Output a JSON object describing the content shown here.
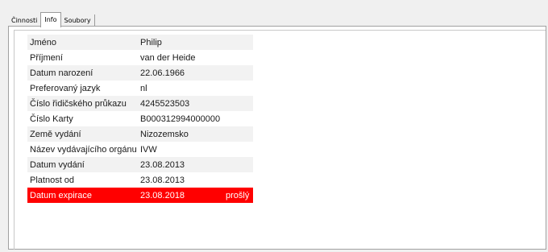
{
  "tabs": [
    {
      "label": "Činnosti"
    },
    {
      "label": "Info"
    },
    {
      "label": "Soubory"
    }
  ],
  "rows": [
    {
      "label": "Jméno",
      "value": "Philip",
      "extra": ""
    },
    {
      "label": "Příjmení",
      "value": "van der Heide",
      "extra": ""
    },
    {
      "label": "Datum narození",
      "value": "22.06.1966",
      "extra": ""
    },
    {
      "label": "Preferovaný jazyk",
      "value": "nl",
      "extra": ""
    },
    {
      "label": "Číslo řidičského průkazu",
      "value": "4245523503",
      "extra": ""
    },
    {
      "label": "Číslo Karty",
      "value": "B000312994000000",
      "extra": ""
    },
    {
      "label": "Země vydání",
      "value": "Nizozemsko",
      "extra": ""
    },
    {
      "label": "Název vydávajícího orgánu",
      "value": "IVW",
      "extra": ""
    },
    {
      "label": "Datum vydání",
      "value": "23.08.2013",
      "extra": ""
    },
    {
      "label": "Platnost od",
      "value": "23.08.2013",
      "extra": ""
    },
    {
      "label": "Datum expirace",
      "value": "23.08.2018",
      "extra": "prošlý"
    }
  ],
  "colors": {
    "expired_row": "#ff0000"
  }
}
